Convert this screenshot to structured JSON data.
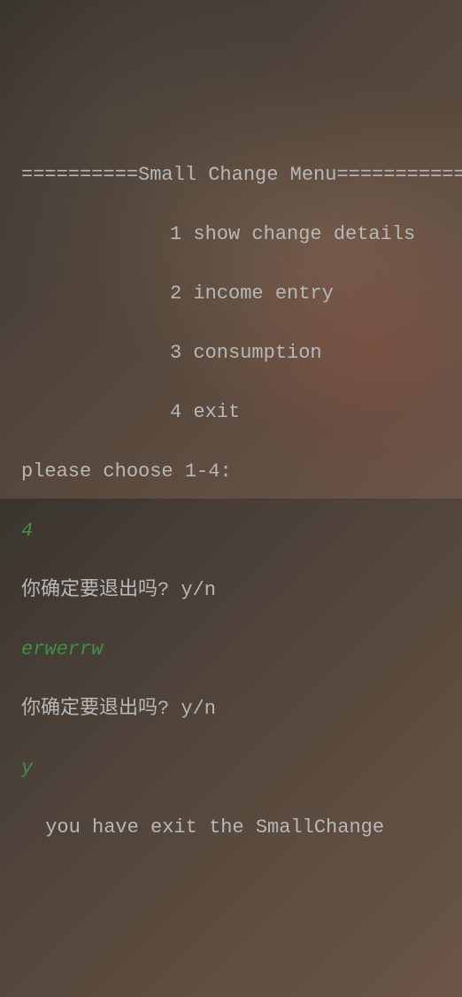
{
  "title_line": "==========Small Change Menu===========",
  "menu": {
    "item1": "1 show change details",
    "item2": "2 income entry",
    "item3": "3 consumption",
    "item4": "4 exit"
  },
  "prompt": "please choose 1-4:",
  "input1": "4",
  "confirm1": "你确定要退出吗? y/n",
  "input2": "erwerrw",
  "confirm2": "你确定要退出吗? y/n",
  "input3": "y",
  "exit_msg": " you have exit the SmallChange"
}
